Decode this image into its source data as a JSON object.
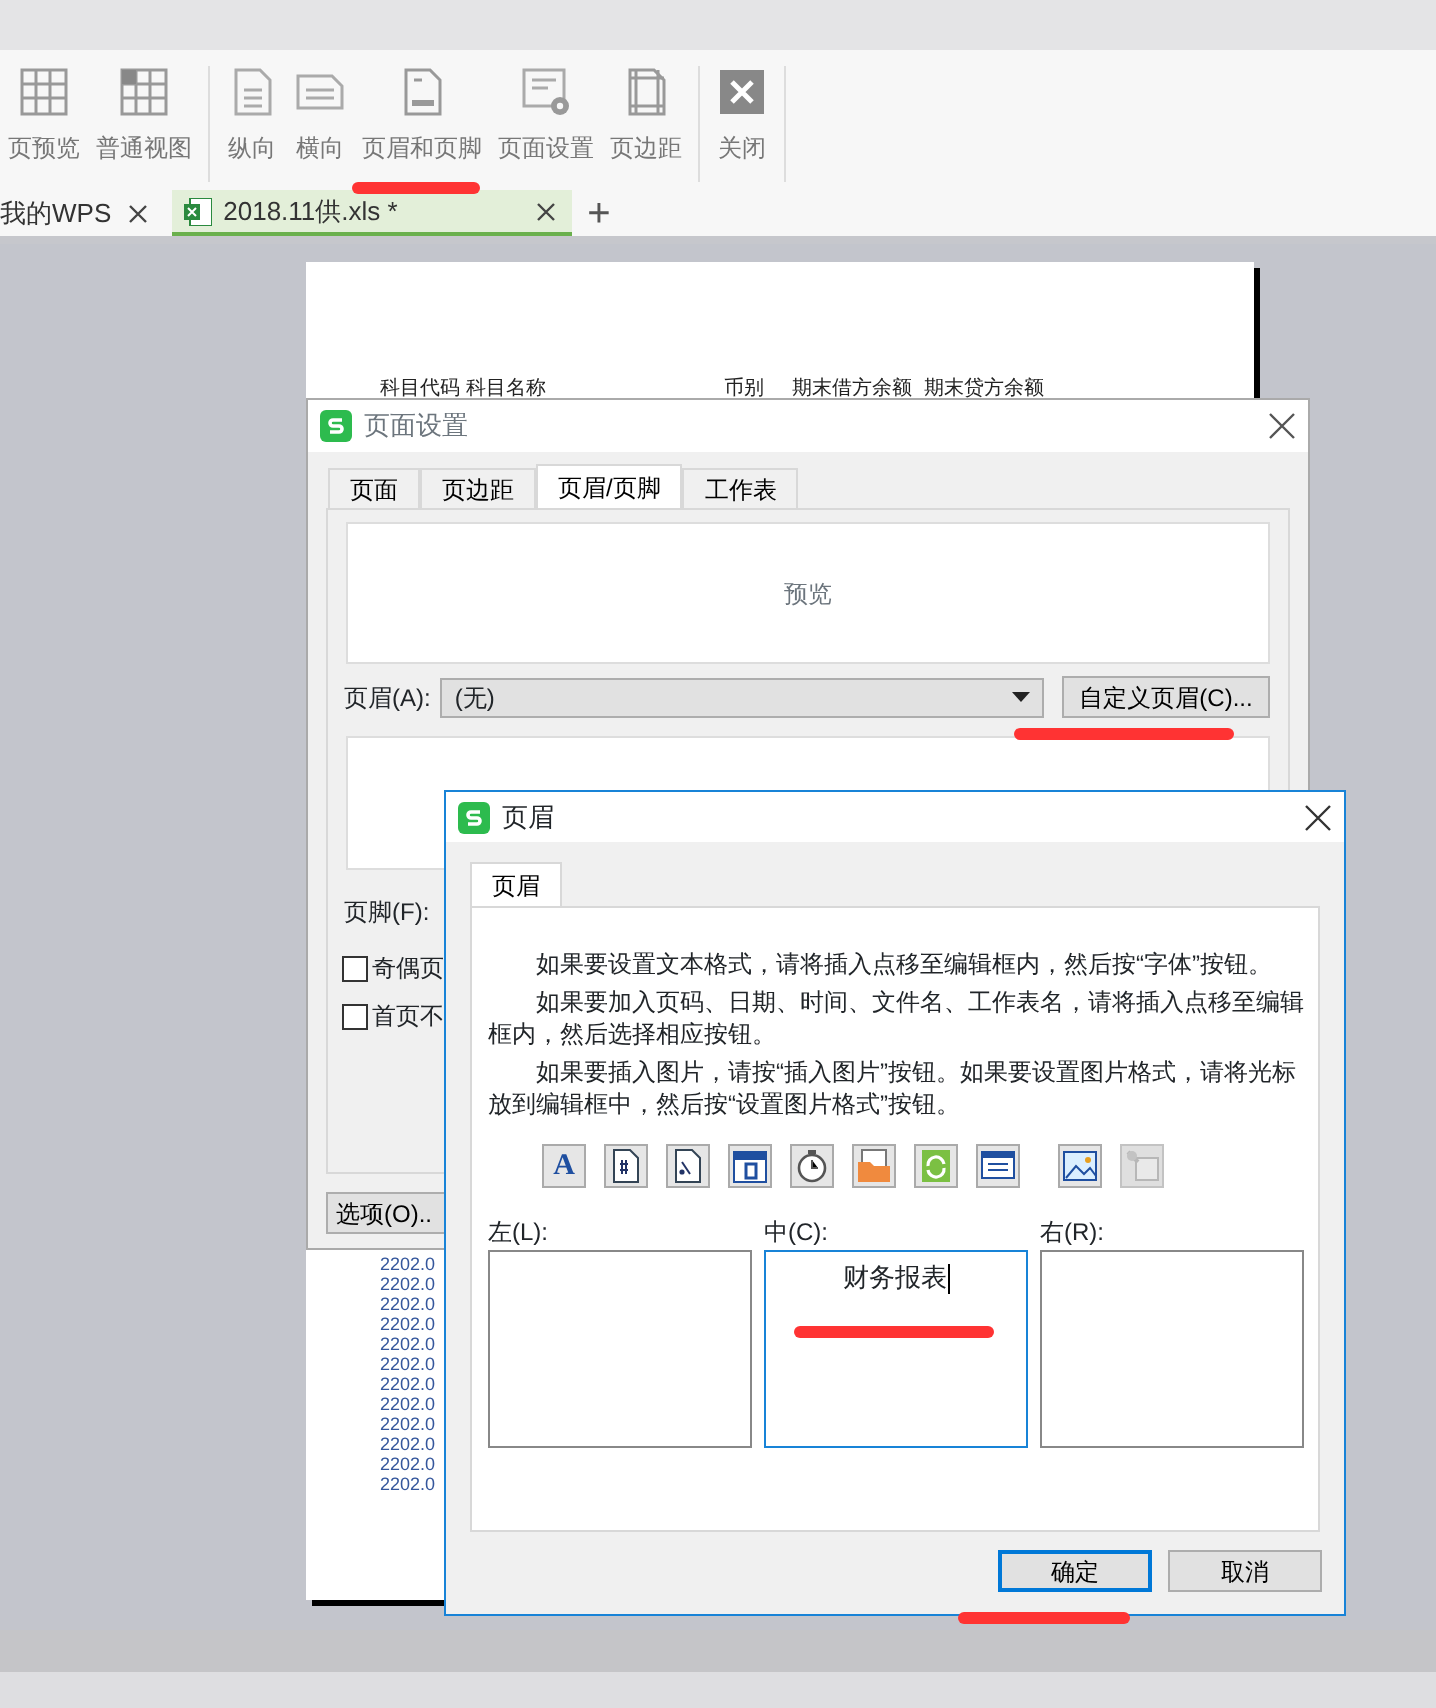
{
  "toolbar": {
    "groups": [
      [
        {
          "label": "页预览",
          "kind": "pagebreak",
          "highlighted": false
        },
        {
          "label": "普通视图",
          "kind": "normal",
          "highlighted": false
        }
      ],
      [
        {
          "label": "纵向",
          "kind": "portrait",
          "highlighted": false
        },
        {
          "label": "横向",
          "kind": "landscape",
          "highlighted": false
        },
        {
          "label": "页眉和页脚",
          "kind": "headerfooter",
          "highlighted": true
        },
        {
          "label": "页面设置",
          "kind": "pagesetup",
          "highlighted": false
        },
        {
          "label": "页边距",
          "kind": "margins",
          "highlighted": false
        }
      ],
      [
        {
          "label": "关闭",
          "kind": "close",
          "highlighted": false
        }
      ]
    ]
  },
  "tabs": [
    {
      "label": "我的WPS",
      "selected": false
    },
    {
      "label": "2018.11供.xls *",
      "selected": true
    }
  ],
  "new_tab": "+",
  "sheet": {
    "header": [
      "科目代码",
      "科目名称",
      "币别",
      "期末借方余额",
      "期末贷方余额"
    ],
    "rows": [
      "2202.0",
      "2202.0",
      "2202.0",
      "2202.0",
      "2202.0",
      "2202.0",
      "2202.0",
      "2202.0",
      "2202.0",
      "2202.0",
      "2202.0",
      "2202.0"
    ]
  },
  "page_setup": {
    "title": "页面设置",
    "tabs": [
      {
        "label": "页面",
        "selected": false
      },
      {
        "label": "页边距",
        "selected": false
      },
      {
        "label": "页眉/页脚",
        "selected": true
      },
      {
        "label": "工作表",
        "selected": false
      }
    ],
    "preview": "预览",
    "header_label": "页眉(A):",
    "header_value": "(无)",
    "custom_header_button": {
      "label": "自定义页眉(C)...",
      "highlighted": true
    },
    "footer_label": "页脚(F):",
    "checkboxes": [
      {
        "label": "奇偶页",
        "checked": false
      },
      {
        "label": "首页不",
        "checked": false
      }
    ],
    "options_button": "选项(O).."
  },
  "header_dialog": {
    "title": "页眉",
    "tab": {
      "label": "页眉",
      "selected": true
    },
    "paragraphs": [
      "如果要设置文本格式，请将插入点移至编辑框内，然后按“字体”按钮。",
      "如果要加入页码、日期、时间、文件名、工作表名，请将插入点移至编辑框内，然后选择相应按钮。",
      "如果要插入图片，请按“插入图片”按钮。如果要设置图片格式，请将光标放到编辑框中，然后按“设置图片格式”按钮。"
    ],
    "icons": [
      {
        "kind": "font",
        "glyph": "A",
        "disabled": false
      },
      {
        "kind": "page-number",
        "disabled": false
      },
      {
        "kind": "page-count",
        "disabled": false
      },
      {
        "kind": "date",
        "disabled": false
      },
      {
        "kind": "time",
        "disabled": false
      },
      {
        "kind": "folder",
        "disabled": false
      },
      {
        "kind": "file",
        "disabled": false
      },
      {
        "kind": "sheet",
        "disabled": false
      },
      {
        "kind": "picture",
        "disabled": false
      },
      {
        "kind": "format-picture",
        "disabled": true
      }
    ],
    "sections": [
      {
        "label": "左(L):",
        "focused": false
      },
      {
        "label": "中(C):",
        "value": "财务报表",
        "focused": true,
        "highlighted": true
      },
      {
        "label": "右(R):",
        "focused": false
      }
    ],
    "buttons": [
      {
        "label": "确定",
        "default": true,
        "highlighted": true
      },
      {
        "label": "取消",
        "default": false,
        "highlighted": false
      }
    ]
  }
}
